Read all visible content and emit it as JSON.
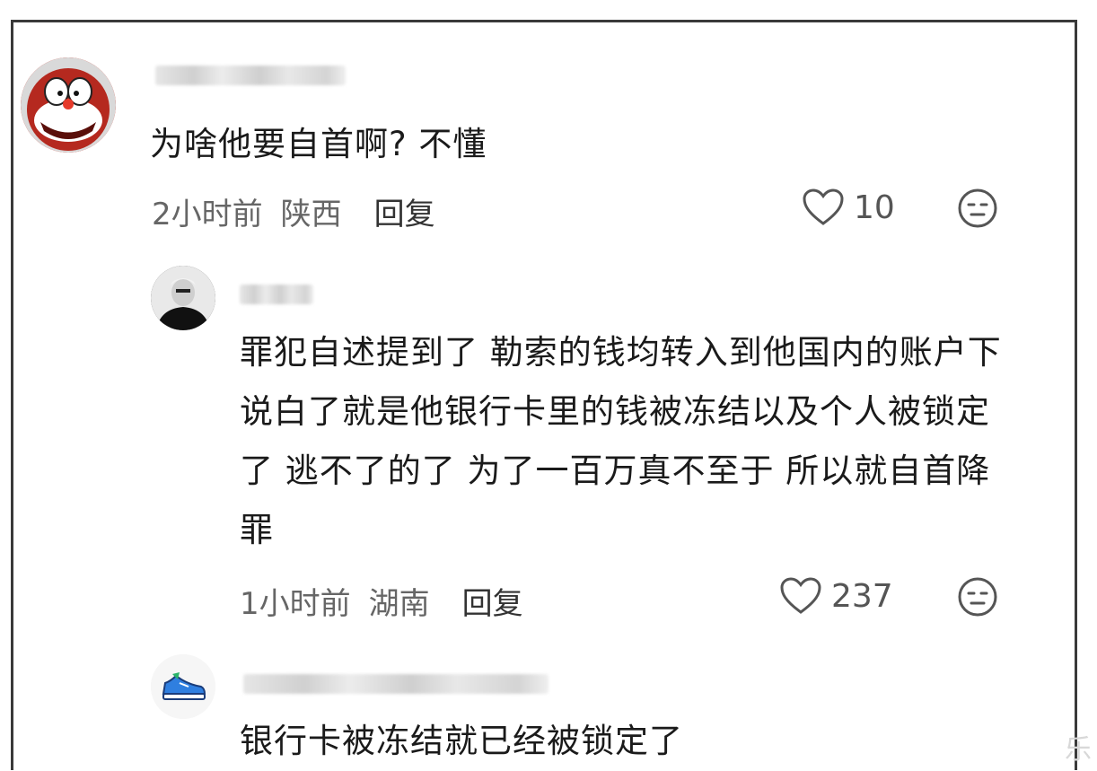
{
  "comments": [
    {
      "text": "为啥他要自首啊? 不懂",
      "time": "2小时前",
      "location": "陕西",
      "reply_label": "回复",
      "likes": "10",
      "avatar_icon": "cartoon-cat-avatar-icon"
    },
    {
      "text": "罪犯自述提到了 勒索的钱均转入到他国内的账户下 说白了就是他银行卡里的钱被冻结以及个人被锁定了 逃不了的了 为了一百万真不至于 所以就自首降罪",
      "time": "1小时前",
      "location": "湖南",
      "reply_label": "回复",
      "likes": "237",
      "avatar_icon": "portrait-photo-avatar-icon"
    },
    {
      "text": "银行卡被冻结就已经被锁定了",
      "avatar_icon": "sneaker-avatar-icon"
    }
  ],
  "watermark": "乐",
  "colors": {
    "text": "#1a1a1a",
    "meta": "#666666",
    "border": "#3a3a3a"
  }
}
